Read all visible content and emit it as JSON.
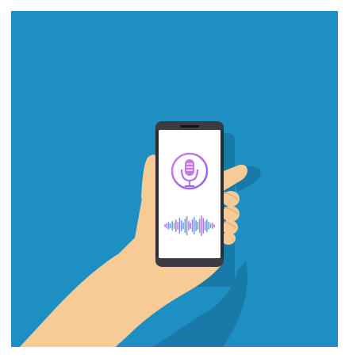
{
  "scene": {
    "description_icons": [
      "microphone-icon",
      "sound-wave-icon"
    ],
    "colors": {
      "background": "#1d8fc2",
      "shadow": "#1978a6",
      "skin": "#f7cb95",
      "skin_shade": "#efbd85",
      "phone_body": "#2a2c31",
      "phone_edge": "#141518",
      "screen": "#ffffff",
      "accent_start": "#c37ae8",
      "accent_end": "#8e63e6",
      "wave_start": "#53d4de",
      "wave_end": "#b45ae6"
    }
  }
}
